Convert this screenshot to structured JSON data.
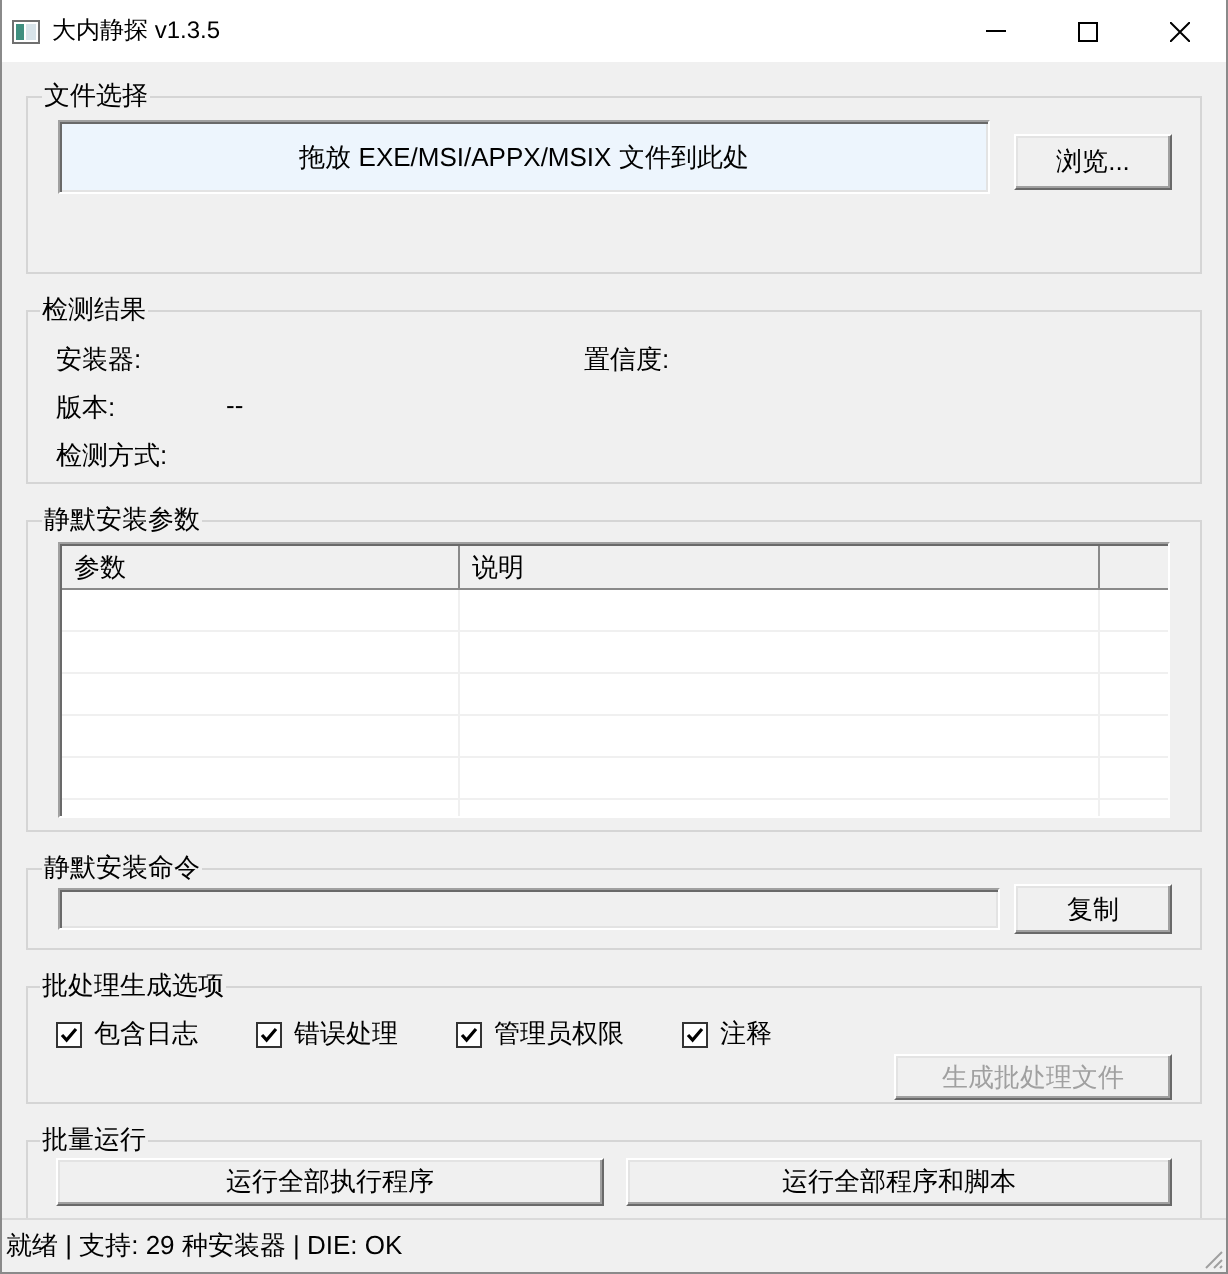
{
  "window": {
    "title": "大内静探 v1.3.5"
  },
  "file_selection": {
    "title": "文件选择",
    "drop_zone": "拖放 EXE/MSI/APPX/MSIX 文件到此处",
    "browse_button": "浏览..."
  },
  "detection_result": {
    "title": "检测结果",
    "rows": [
      {
        "fields": [
          {
            "label": "安装器:"
          },
          {
            "label": "置信度:"
          }
        ]
      },
      {
        "fields": [
          {
            "label": "版本:",
            "value": "--"
          }
        ]
      },
      {
        "fields": [
          {
            "label": "检测方式:"
          }
        ]
      }
    ]
  },
  "silent_params": {
    "title": "静默安装参数",
    "table": {
      "columns": [
        "参数",
        "说明"
      ]
    }
  },
  "silent_command": {
    "title": "静默安装命令",
    "copy_button": "复制"
  },
  "batch_options": {
    "title": "批处理生成选项",
    "options": [
      {
        "label": "包含日志",
        "checked": true
      },
      {
        "label": "错误处理",
        "checked": true
      },
      {
        "label": "管理员权限",
        "checked": true
      },
      {
        "label": "注释",
        "checked": true
      }
    ],
    "generate_button": {
      "label": "生成批处理文件",
      "disabled": true
    }
  },
  "batch_run": {
    "title": "批量运行",
    "buttons": [
      "运行全部执行程序",
      "运行全部程序和脚本"
    ]
  },
  "status_bar": {
    "text": "就绪 | 支持: 29 种安装器 | DIE: OK"
  }
}
